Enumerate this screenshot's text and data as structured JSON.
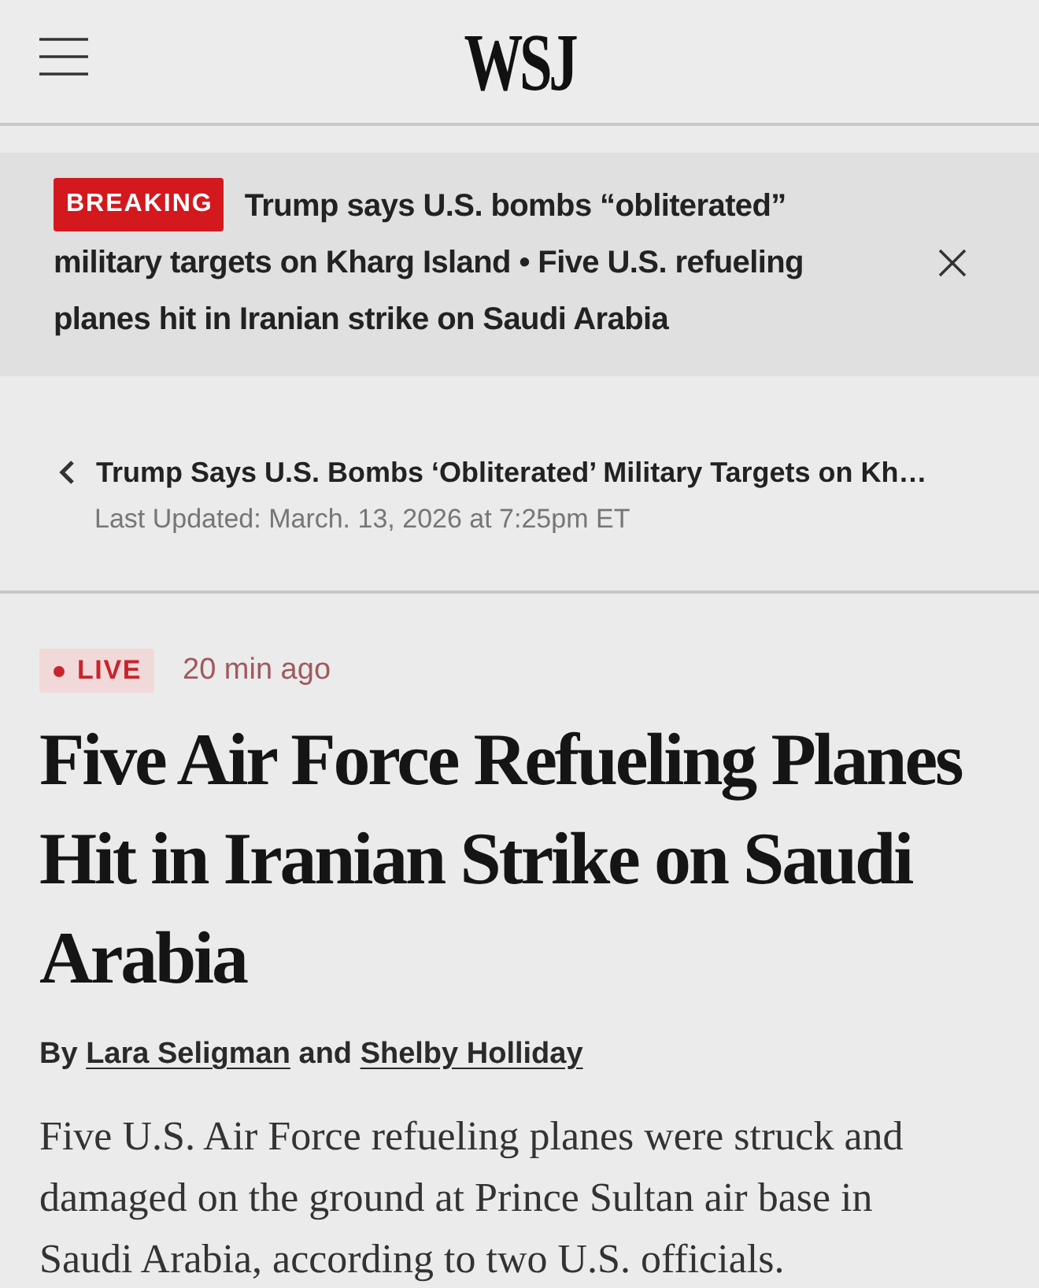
{
  "header": {
    "logo": "WSJ"
  },
  "breaking_banner": {
    "badge": "BREAKING",
    "text": "Trump says U.S. bombs “obliterated” military targets on Kharg Island • Five U.S. refueling planes hit in Iranian strike on Saudi Arabia"
  },
  "back_link": {
    "title": "Trump Says U.S. Bombs ‘Obliterated’ Military Targets on Kh…",
    "last_updated": "Last Updated: March. 13, 2026 at 7:25pm ET"
  },
  "article": {
    "live_badge": "LIVE",
    "timestamp": "20 min ago",
    "headline": "Five Air Force Refueling Planes Hit in Iranian Strike on Saudi Arabia",
    "byline": {
      "prefix": "By",
      "authors": [
        "Lara Seligman",
        "Shelby Holliday"
      ],
      "joiner": "and"
    },
    "body": "Five U.S. Air Force refueling planes were struck and damaged on the ground at Prince Sultan air base in Saudi Arabia, according to two U.S. officials."
  }
}
